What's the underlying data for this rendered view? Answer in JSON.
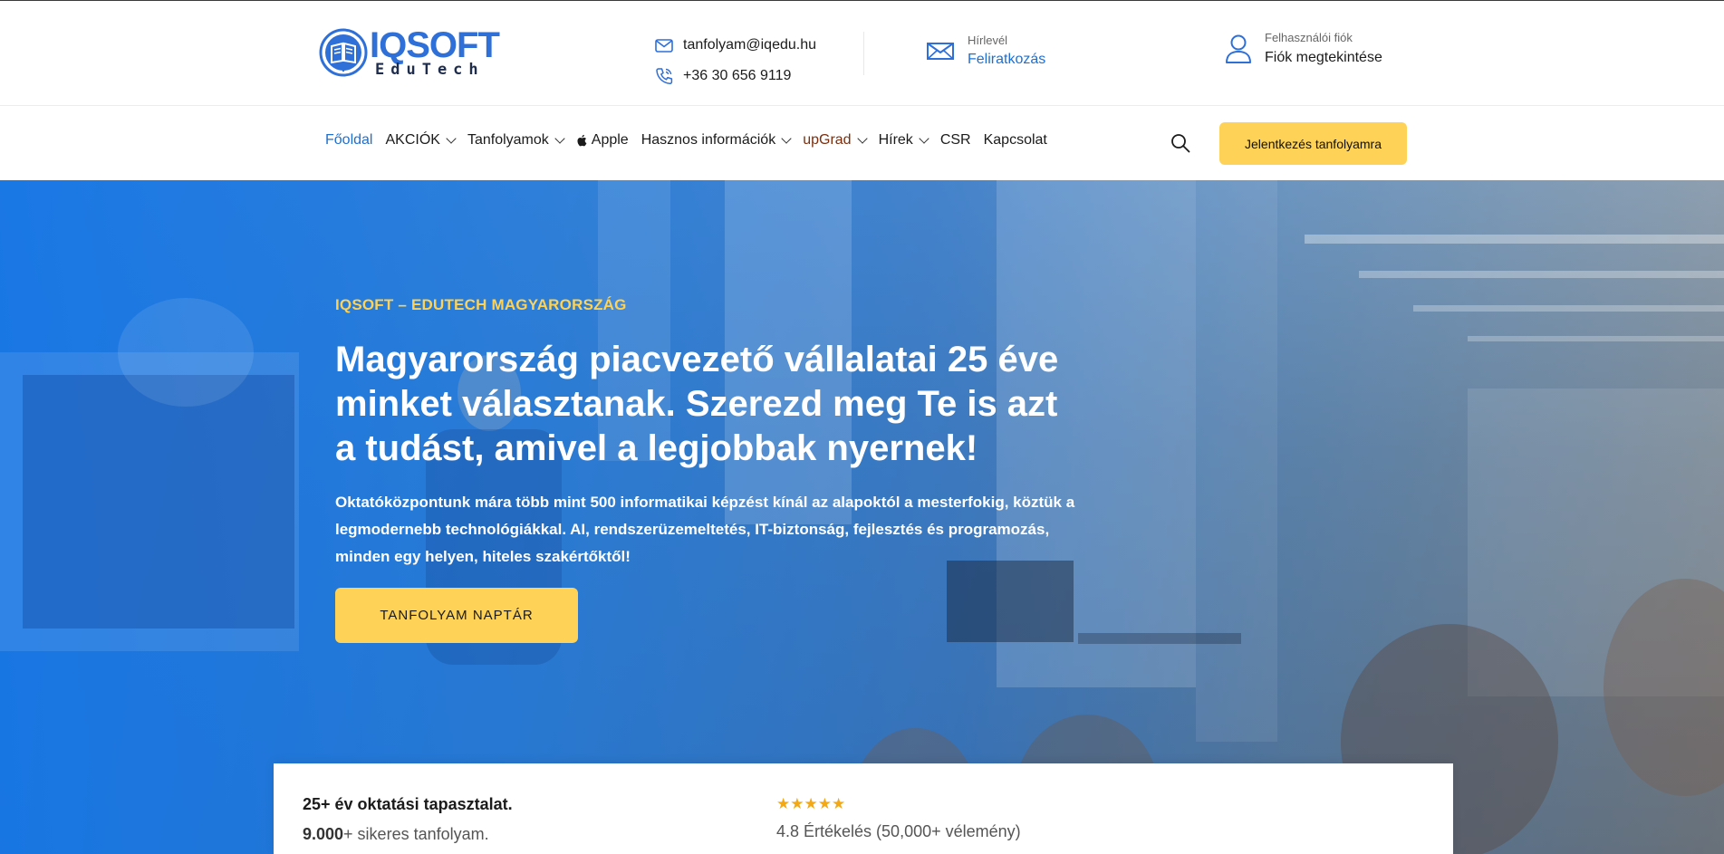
{
  "brand": {
    "name": "IQSOFT",
    "sub": "EduTech",
    "accent": "#2e6fd8",
    "cta_color": "#fdd257"
  },
  "contact": {
    "email": "tanfolyam@iqedu.hu",
    "phone": "+36 30 656 9119",
    "email_icon": "mail-icon",
    "phone_icon": "phone-icon"
  },
  "newsletter": {
    "small": "Hírlevél",
    "link": "Feliratkozás",
    "icon": "envelope-icon"
  },
  "account": {
    "small": "Felhasználói fiók",
    "link": "Fiók megtekintése",
    "icon": "user-icon"
  },
  "nav": {
    "items": [
      {
        "label": "Főoldal",
        "dropdown": false
      },
      {
        "label": "AKCIÓK",
        "dropdown": true
      },
      {
        "label": "Tanfolyamok",
        "dropdown": true
      },
      {
        "label": "Apple",
        "dropdown": false
      },
      {
        "label": "Hasznos információk",
        "dropdown": true
      },
      {
        "label": "upGrad",
        "dropdown": true
      },
      {
        "label": "Hírek",
        "dropdown": true
      },
      {
        "label": "CSR",
        "dropdown": false
      },
      {
        "label": "Kapcsolat",
        "dropdown": false
      }
    ],
    "search_icon": "search-icon",
    "cta": "Jelentkezés tanfolyamra"
  },
  "hero": {
    "kicker": "IQSOFT – EDUTECH MAGYARORSZÁG",
    "title": "Magyarország piacvezető vállalatai 25 éve minket választanak. Szerezd meg Te is azt a tudást, amivel a legjobbak nyernek!",
    "text": "Oktatóközpontunk mára több mint 500 informatikai képzést kínál az alapoktól a mesterfokig, köztük a legmodernebb technológiákkal. AI, rendszerüzemeltetés, IT-biztonság, fejlesztés és programozás, minden egy helyen, hiteles szakértőktől!",
    "button": "TANFOLYAM NAPTÁR"
  },
  "stats": {
    "experience": "25+ év oktatási tapasztalat.",
    "courses_count": "9.000",
    "courses_suffix": "+ sikeres tanfolyam.",
    "stars": "★★★★★",
    "rating": "4.8 Értékelés (50,000+ vélemény)"
  }
}
